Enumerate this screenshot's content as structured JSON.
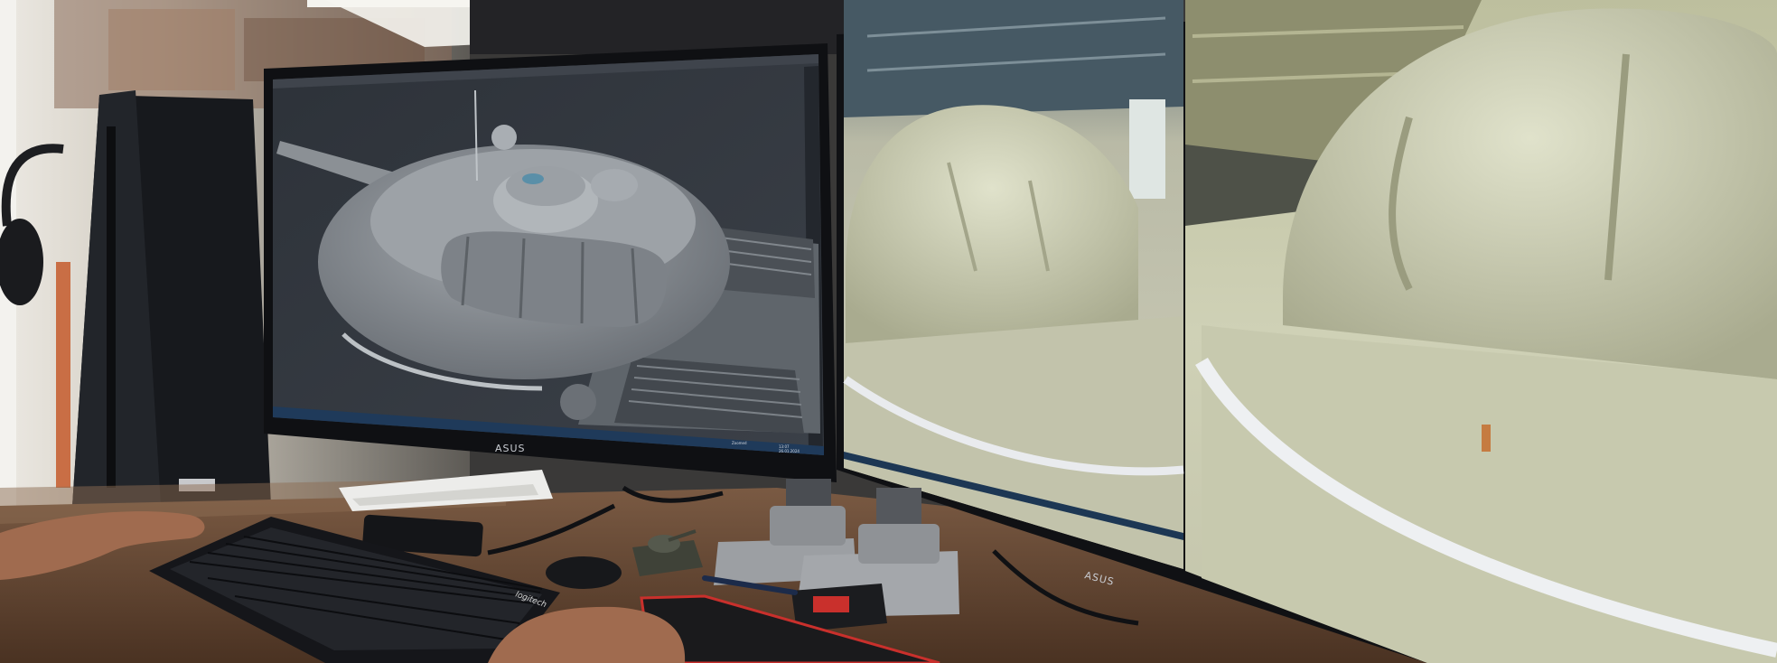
{
  "scene": {
    "left_monitor": {
      "brand": "ASUS",
      "screen": {
        "app": "3d-modeling-viewport",
        "subject": "tank-turret-mesh",
        "status_text": "Zoomed",
        "tray_time": "13:07",
        "tray_date": "26.01.2024"
      }
    },
    "right_monitor": {
      "brand": "ASUS",
      "screen": {
        "left_photo": "tank-turret-reference-photo",
        "right_photo": "tank-turret-closeup-photo"
      }
    },
    "keyboard": {
      "brand": "logitech"
    },
    "colors": {
      "wall": "#d8d3c8",
      "desk": "#6b4a33",
      "screen_bg": "#2f343c",
      "model_gray": "#8a9096",
      "tank_photo": "#c9c9b2",
      "accent_red": "#c9302c"
    }
  }
}
